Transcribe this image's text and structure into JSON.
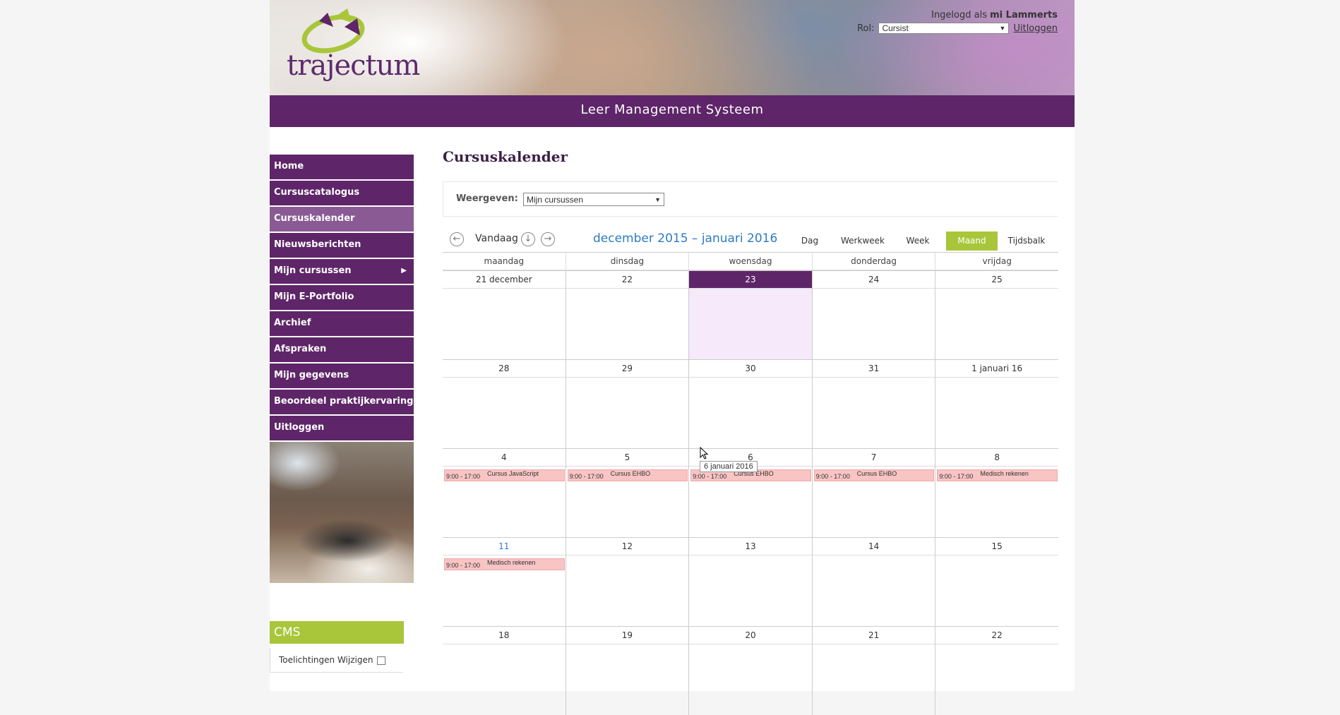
{
  "header": {
    "logo_text": "trajectum",
    "logged_in_prefix": "Ingelogd als",
    "username": "mi Lammerts",
    "role_label": "Rol:",
    "role_value": "Cursist",
    "logout_label": "Uitloggen",
    "system_title": "Leer Management Systeem"
  },
  "sidebar": {
    "items": [
      {
        "label": "Home"
      },
      {
        "label": "Cursuscatalogus"
      },
      {
        "label": "Cursuskalender",
        "active": true
      },
      {
        "label": "Nieuwsberichten"
      },
      {
        "label": "Mijn cursussen",
        "submenu": true
      },
      {
        "label": "Mijn E-Portfolio"
      },
      {
        "label": "Archief"
      },
      {
        "label": "Afspraken"
      },
      {
        "label": "Mijn gegevens"
      },
      {
        "label": "Beoordeel praktijkervaring"
      },
      {
        "label": "Uitloggen"
      }
    ],
    "cms_title": "CMS",
    "cms_toggle_label": "Toelichtingen Wijzigen"
  },
  "main": {
    "title": "Cursuskalender",
    "filter_label": "Weergeven:",
    "filter_value": "Mijn cursussen",
    "today_label": "Vandaag",
    "range_label": "december 2015 – januari 2016",
    "views": [
      {
        "label": "Dag"
      },
      {
        "label": "Werkweek"
      },
      {
        "label": "Week"
      },
      {
        "label": "Maand",
        "active": true
      },
      {
        "label": "Tijdsbalk"
      }
    ]
  },
  "calendar": {
    "weekdays": [
      "maandag",
      "dinsdag",
      "woensdag",
      "donderdag",
      "vrijdag"
    ],
    "weeks": [
      {
        "days": [
          {
            "label": "21 december"
          },
          {
            "label": "22"
          },
          {
            "label": "23",
            "today": true
          },
          {
            "label": "24"
          },
          {
            "label": "25"
          }
        ]
      },
      {
        "days": [
          {
            "label": "28"
          },
          {
            "label": "29"
          },
          {
            "label": "30"
          },
          {
            "label": "31"
          },
          {
            "label": "1 januari 16"
          }
        ]
      },
      {
        "days": [
          {
            "label": "4",
            "event": {
              "time": "9:00 - 17:00",
              "name": "Cursus JavaScript"
            }
          },
          {
            "label": "5",
            "event": {
              "time": "9:00 - 17:00",
              "name": "Cursus EHBO"
            }
          },
          {
            "label": "6",
            "event": {
              "time": "9:00 - 17:00",
              "name": "Cursus EHBO"
            }
          },
          {
            "label": "7",
            "event": {
              "time": "9:00 - 17:00",
              "name": "Cursus EHBO"
            }
          },
          {
            "label": "8",
            "event": {
              "time": "9:00 - 17:00",
              "name": "Medisch rekenen"
            }
          }
        ]
      },
      {
        "days": [
          {
            "label": "11",
            "highlight": true,
            "event": {
              "time": "9:00 - 17:00",
              "name": "Medisch rekenen"
            }
          },
          {
            "label": "12"
          },
          {
            "label": "13"
          },
          {
            "label": "14"
          },
          {
            "label": "15"
          }
        ]
      },
      {
        "days": [
          {
            "label": "18"
          },
          {
            "label": "19"
          },
          {
            "label": "20"
          },
          {
            "label": "21"
          },
          {
            "label": "22"
          }
        ]
      }
    ],
    "tooltip": "6 januari 2016"
  },
  "colors": {
    "brand_purple": "#5e2568",
    "active_nav": "#8a5a94",
    "accent_green": "#a9c63a",
    "range_blue": "#2c7bc2",
    "event_bg": "#f8c4c4",
    "today_bg": "#f5e9fa"
  }
}
